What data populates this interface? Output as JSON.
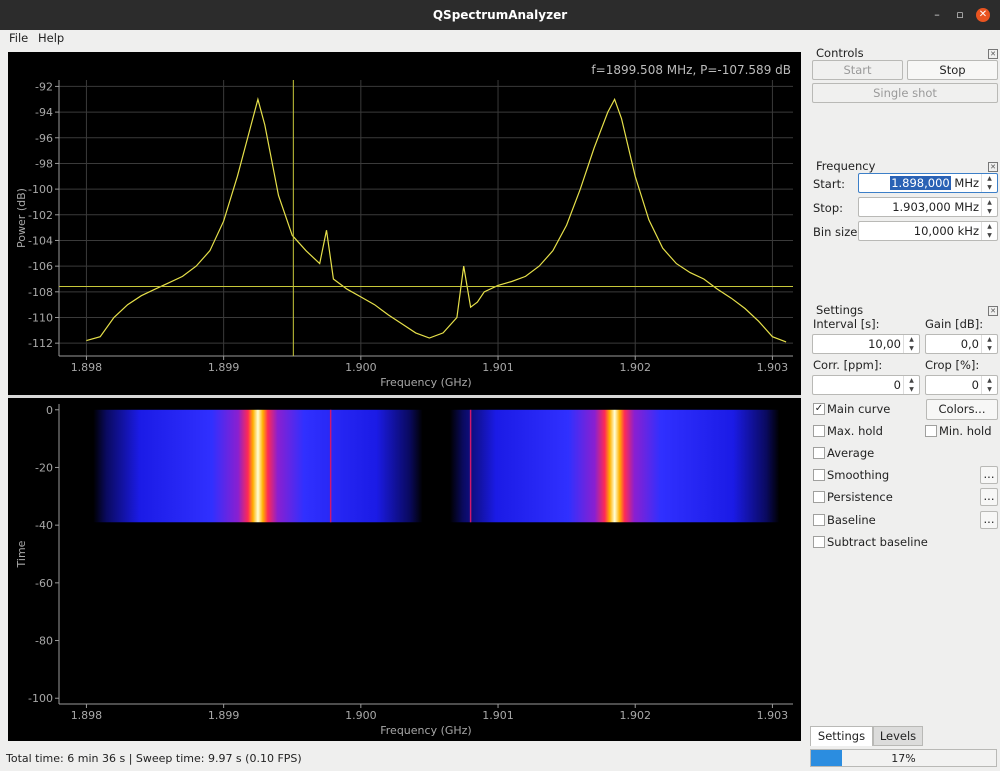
{
  "window": {
    "title": "QSpectrumAnalyzer"
  },
  "menu": {
    "file": "File",
    "help": "Help"
  },
  "readout": "f=1899.508 MHz, P=-107.589 dB",
  "controls": {
    "title": "Controls",
    "start": "Start",
    "stop": "Stop",
    "single_shot": "Single shot"
  },
  "frequency": {
    "title": "Frequency",
    "start_label": "Start:",
    "start_value": "1.898,000",
    "start_unit": "MHz",
    "stop_label": "Stop:",
    "stop_value": "1.903,000 MHz",
    "bin_label": "Bin size:",
    "bin_value": "10,000 kHz"
  },
  "settings": {
    "title": "Settings",
    "interval_label": "Interval [s]:",
    "interval_value": "10,00",
    "gain_label": "Gain [dB]:",
    "gain_value": "0,0",
    "corr_label": "Corr. [ppm]:",
    "corr_value": "0",
    "crop_label": "Crop [%]:",
    "crop_value": "0",
    "main_curve": "Main curve",
    "colors": "Colors...",
    "max_hold": "Max. hold",
    "min_hold": "Min. hold",
    "average": "Average",
    "smoothing": "Smoothing",
    "persistence": "Persistence",
    "baseline": "Baseline",
    "subtract_baseline": "Subtract baseline",
    "more": "..."
  },
  "tabs": {
    "settings": "Settings",
    "levels": "Levels"
  },
  "progress": {
    "fraction": 0.17,
    "text": "17%"
  },
  "status": "Total time: 6 min 36 s | Sweep time: 9.97 s (0.10 FPS)",
  "colors": {
    "curve": "#e6e04a",
    "crosshair": "#c8c83a",
    "accent": "#2b8de0"
  },
  "chart_data": [
    {
      "type": "line",
      "ylabel": "Power (dB)",
      "xlabel": "Frequency (GHz)",
      "xlim": [
        1.8978,
        1.90315
      ],
      "ylim": [
        -113,
        -91.5
      ],
      "xticks": [
        "1.898",
        "1.899",
        "1.900",
        "1.901",
        "1.902",
        "1.903"
      ],
      "yticks": [
        "-92",
        "-94",
        "-96",
        "-98",
        "-100",
        "-102",
        "-104",
        "-106",
        "-108",
        "-110",
        "-112"
      ],
      "grid": true,
      "cursor": {
        "x": 1.899508,
        "y": -107.589
      },
      "x": [
        1.898,
        1.8981,
        1.8982,
        1.8983,
        1.8984,
        1.8985,
        1.8986,
        1.8987,
        1.8988,
        1.8989,
        1.899,
        1.8991,
        1.8992,
        1.89925,
        1.8993,
        1.8994,
        1.8995,
        1.8996,
        1.8997,
        1.89975,
        1.8998,
        1.8999,
        1.9,
        1.9001,
        1.9002,
        1.9003,
        1.9004,
        1.9005,
        1.9006,
        1.9007,
        1.90075,
        1.9008,
        1.90085,
        1.9009,
        1.901,
        1.9011,
        1.9012,
        1.9013,
        1.9014,
        1.9015,
        1.9016,
        1.9017,
        1.9018,
        1.90185,
        1.9019,
        1.902,
        1.9021,
        1.9022,
        1.9023,
        1.9024,
        1.9025,
        1.9026,
        1.9027,
        1.9028,
        1.9029,
        1.903,
        1.9031
      ],
      "y": [
        -111.8,
        -111.5,
        -110.0,
        -109.0,
        -108.3,
        -107.8,
        -107.3,
        -106.8,
        -106.0,
        -104.8,
        -102.5,
        -99.0,
        -95.0,
        -93.0,
        -95.0,
        -100.5,
        -103.6,
        -104.8,
        -105.8,
        -103.2,
        -107.0,
        -107.8,
        -108.4,
        -109.0,
        -109.8,
        -110.5,
        -111.2,
        -111.6,
        -111.2,
        -110.0,
        -106.0,
        -109.2,
        -108.8,
        -108.0,
        -107.5,
        -107.2,
        -106.8,
        -106.0,
        -104.8,
        -102.8,
        -100.0,
        -96.8,
        -94.0,
        -93.0,
        -94.5,
        -99.0,
        -102.4,
        -104.6,
        -105.8,
        -106.5,
        -107.0,
        -107.8,
        -108.5,
        -109.3,
        -110.3,
        -111.5,
        -111.9
      ]
    },
    {
      "type": "heatmap",
      "ylabel": "Time",
      "xlabel": "Frequency (GHz)",
      "xlim": [
        1.8978,
        1.90315
      ],
      "ylim": [
        -102,
        2
      ],
      "xticks": [
        "1.898",
        "1.899",
        "1.900",
        "1.901",
        "1.902",
        "1.903"
      ],
      "yticks": [
        "0",
        "-20",
        "-40",
        "-60",
        "-80",
        "-100"
      ],
      "populated_time_range": [
        0,
        -39
      ],
      "bands": [
        {
          "x_range": [
            1.89805,
            1.90045
          ],
          "peak": 1.89925,
          "minor_line": 1.89978
        },
        {
          "x_range": [
            1.90065,
            1.90305
          ],
          "peak": 1.90185,
          "minor_line": 1.9008
        }
      ]
    }
  ]
}
